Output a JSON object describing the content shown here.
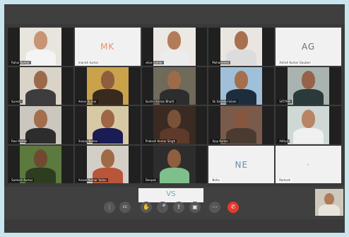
{
  "meeting": {
    "tiles": [
      {
        "name": "Rahul Kumar",
        "initials": "",
        "bg": "#e8e4de",
        "skin": "#c79573",
        "shirt": "#f4f4f4"
      },
      {
        "name": "manish kumar",
        "initials": "MK",
        "ini_color": "#e8926b"
      },
      {
        "name": "vikas kumar",
        "initials": "",
        "bg": "#ece8e4",
        "skin": "#b37c59",
        "shirt": "#ececec"
      },
      {
        "name": "Mohammed",
        "initials": "",
        "bg": "#e9e5e0",
        "skin": "#a9704f",
        "shirt": "#dcdcdc"
      },
      {
        "name": "Ashish Kumar Gautam",
        "initials": "AG",
        "ini_color": "#6e6e6e"
      },
      {
        "name": "Suresh",
        "initials": "",
        "bg": "#d9d3c8",
        "skin": "#9c6a4b",
        "shirt": "#3d3d3d"
      },
      {
        "name": "Aman Kumar",
        "initials": "",
        "bg": "#c9a24b",
        "skin": "#8f5e3f",
        "shirt": "#3a2a1d"
      },
      {
        "name": "Sachin Kumar Bharti",
        "initials": "",
        "bg": "#6f6a5a",
        "skin": "#9e6b49",
        "shirt": "#2d2d2d"
      },
      {
        "name": "Sk Sahabul Islam",
        "initials": "",
        "bg": "#9fc0d8",
        "skin": "#a56f4d",
        "shirt": "#1d2d3d"
      },
      {
        "name": "SATYAM",
        "initials": "",
        "bg": "#a9b3b0",
        "skin": "#97624a",
        "shirt": "#2a3a3a"
      },
      {
        "name": "Ravi Kumar",
        "initials": "",
        "bg": "#cbc6be",
        "skin": "#a26e4d",
        "shirt": "#2d2d2d"
      },
      {
        "name": "Sanjay Kumar",
        "initials": "",
        "bg": "#d8c9a5",
        "skin": "#9d6646",
        "shirt": "#1b1b55"
      },
      {
        "name": "Prakash Kumar Singh",
        "initials": "",
        "bg": "#3a2a22",
        "skin": "#7a5238",
        "shirt": "#5d3a2a"
      },
      {
        "name": "Ajay Kumar",
        "initials": "",
        "bg": "#7a5a4a",
        "skin": "#86563d",
        "shirt": "#4a3a30"
      },
      {
        "name": "Aditya",
        "initials": "",
        "bg": "#cfd8d4",
        "skin": "#b98463",
        "shirt": "#f0f0f0"
      },
      {
        "name": "Santosh Kumar",
        "initials": "",
        "bg": "#5d7a3e",
        "skin": "#6f4a30",
        "shirt": "#2d3d1f"
      },
      {
        "name": "Anand Kumar Yadav",
        "initials": "",
        "bg": "#d4cfc6",
        "skin": "#a06a47",
        "shirt": "#b8553a"
      },
      {
        "name": "Deepak",
        "initials": "",
        "bg": "#2d2d2d",
        "skin": "#8f5e3f",
        "shirt": "#7fbf8c"
      },
      {
        "name": "Neha",
        "initials": "NE",
        "ini_color": "#5a92b8"
      },
      {
        "name": "Ramesh",
        "initials": "·",
        "ini_color": "#9a9a9a"
      }
    ],
    "vs_tile": {
      "initials": "VS"
    },
    "controls": [
      {
        "id": "more",
        "glyph": "⋮"
      },
      {
        "id": "cc",
        "glyph": "cc"
      },
      {
        "id": "hand",
        "glyph": "✋"
      },
      {
        "id": "mic",
        "glyph": "🎤"
      },
      {
        "id": "present",
        "glyph": "⇪"
      },
      {
        "id": "camera",
        "glyph": "▣"
      },
      {
        "id": "options",
        "glyph": "⋯"
      },
      {
        "id": "end",
        "glyph": "✆"
      }
    ]
  }
}
